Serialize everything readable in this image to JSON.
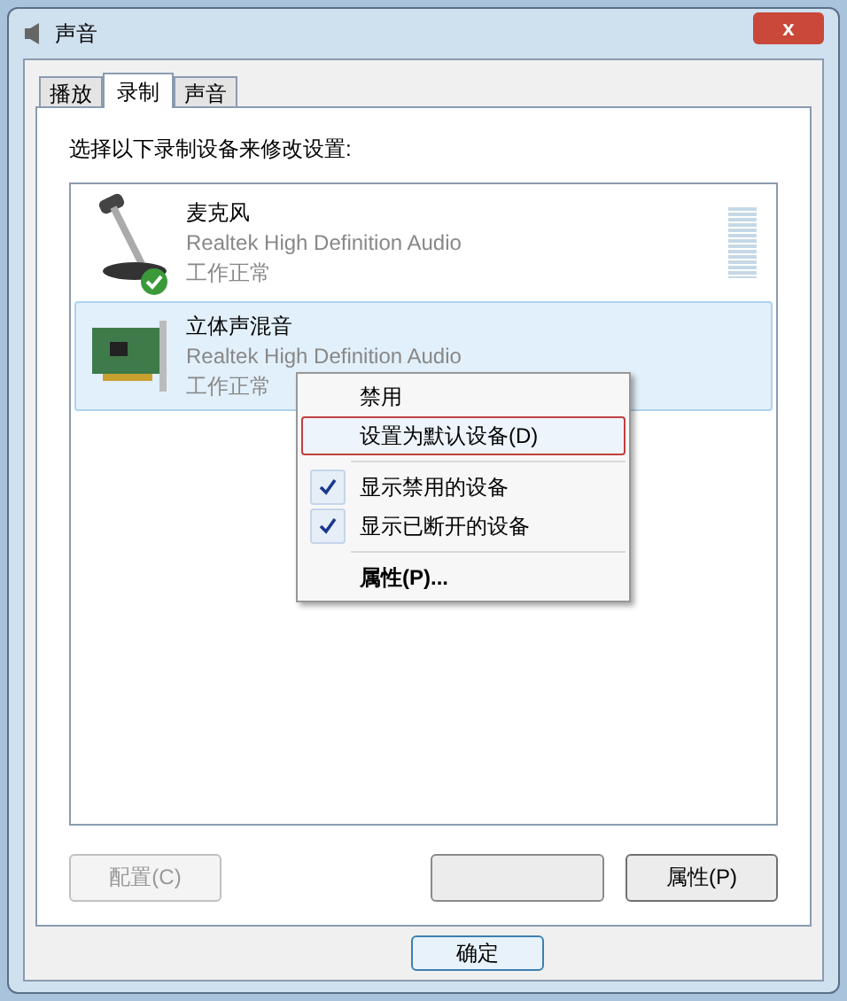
{
  "window": {
    "title": "声音",
    "close_label": "x"
  },
  "tabs": [
    {
      "label": "播放",
      "selected": false
    },
    {
      "label": "录制",
      "selected": true
    },
    {
      "label": "声音",
      "selected": false
    }
  ],
  "instruction": "选择以下录制设备来修改设置:",
  "devices": [
    {
      "kind": "microphone",
      "name": "麦克风",
      "driver": "Realtek High Definition Audio",
      "status": "工作正常",
      "selected": false,
      "is_default": true,
      "meter": true
    },
    {
      "kind": "card",
      "name": "立体声混音",
      "driver": "Realtek High Definition Audio",
      "status": "工作正常",
      "selected": true,
      "is_default": false
    }
  ],
  "context_menu": [
    {
      "kind": "item",
      "label": "禁用",
      "checked": false,
      "selected": false,
      "bold": false
    },
    {
      "kind": "item",
      "label": "设置为默认设备(D)",
      "checked": false,
      "selected": true,
      "bold": false
    },
    {
      "kind": "separator"
    },
    {
      "kind": "item",
      "label": "显示禁用的设备",
      "checked": true,
      "selected": false,
      "bold": false
    },
    {
      "kind": "item",
      "label": "显示已断开的设备",
      "checked": true,
      "selected": false,
      "bold": false
    },
    {
      "kind": "separator"
    },
    {
      "kind": "item",
      "label": "属性(P)...",
      "checked": false,
      "selected": false,
      "bold": true
    }
  ],
  "buttons": [
    {
      "label": "配置(C)",
      "disabled": true
    },
    {
      "label": "属性(P)",
      "disabled": false
    }
  ],
  "footer_buttons": [
    {
      "label": "确定",
      "disabled": false
    }
  ]
}
